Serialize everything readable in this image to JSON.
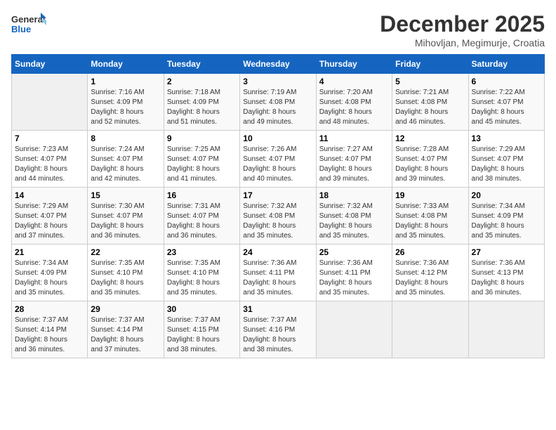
{
  "logo": {
    "line1": "General",
    "line2": "Blue"
  },
  "title": "December 2025",
  "subtitle": "Mihovljan, Megimurje, Croatia",
  "days_of_week": [
    "Sunday",
    "Monday",
    "Tuesday",
    "Wednesday",
    "Thursday",
    "Friday",
    "Saturday"
  ],
  "weeks": [
    [
      {
        "day": "",
        "info": ""
      },
      {
        "day": "1",
        "info": "Sunrise: 7:16 AM\nSunset: 4:09 PM\nDaylight: 8 hours\nand 52 minutes."
      },
      {
        "day": "2",
        "info": "Sunrise: 7:18 AM\nSunset: 4:09 PM\nDaylight: 8 hours\nand 51 minutes."
      },
      {
        "day": "3",
        "info": "Sunrise: 7:19 AM\nSunset: 4:08 PM\nDaylight: 8 hours\nand 49 minutes."
      },
      {
        "day": "4",
        "info": "Sunrise: 7:20 AM\nSunset: 4:08 PM\nDaylight: 8 hours\nand 48 minutes."
      },
      {
        "day": "5",
        "info": "Sunrise: 7:21 AM\nSunset: 4:08 PM\nDaylight: 8 hours\nand 46 minutes."
      },
      {
        "day": "6",
        "info": "Sunrise: 7:22 AM\nSunset: 4:07 PM\nDaylight: 8 hours\nand 45 minutes."
      }
    ],
    [
      {
        "day": "7",
        "info": "Sunrise: 7:23 AM\nSunset: 4:07 PM\nDaylight: 8 hours\nand 44 minutes."
      },
      {
        "day": "8",
        "info": "Sunrise: 7:24 AM\nSunset: 4:07 PM\nDaylight: 8 hours\nand 42 minutes."
      },
      {
        "day": "9",
        "info": "Sunrise: 7:25 AM\nSunset: 4:07 PM\nDaylight: 8 hours\nand 41 minutes."
      },
      {
        "day": "10",
        "info": "Sunrise: 7:26 AM\nSunset: 4:07 PM\nDaylight: 8 hours\nand 40 minutes."
      },
      {
        "day": "11",
        "info": "Sunrise: 7:27 AM\nSunset: 4:07 PM\nDaylight: 8 hours\nand 39 minutes."
      },
      {
        "day": "12",
        "info": "Sunrise: 7:28 AM\nSunset: 4:07 PM\nDaylight: 8 hours\nand 39 minutes."
      },
      {
        "day": "13",
        "info": "Sunrise: 7:29 AM\nSunset: 4:07 PM\nDaylight: 8 hours\nand 38 minutes."
      }
    ],
    [
      {
        "day": "14",
        "info": "Sunrise: 7:29 AM\nSunset: 4:07 PM\nDaylight: 8 hours\nand 37 minutes."
      },
      {
        "day": "15",
        "info": "Sunrise: 7:30 AM\nSunset: 4:07 PM\nDaylight: 8 hours\nand 36 minutes."
      },
      {
        "day": "16",
        "info": "Sunrise: 7:31 AM\nSunset: 4:07 PM\nDaylight: 8 hours\nand 36 minutes."
      },
      {
        "day": "17",
        "info": "Sunrise: 7:32 AM\nSunset: 4:08 PM\nDaylight: 8 hours\nand 35 minutes."
      },
      {
        "day": "18",
        "info": "Sunrise: 7:32 AM\nSunset: 4:08 PM\nDaylight: 8 hours\nand 35 minutes."
      },
      {
        "day": "19",
        "info": "Sunrise: 7:33 AM\nSunset: 4:08 PM\nDaylight: 8 hours\nand 35 minutes."
      },
      {
        "day": "20",
        "info": "Sunrise: 7:34 AM\nSunset: 4:09 PM\nDaylight: 8 hours\nand 35 minutes."
      }
    ],
    [
      {
        "day": "21",
        "info": "Sunrise: 7:34 AM\nSunset: 4:09 PM\nDaylight: 8 hours\nand 35 minutes."
      },
      {
        "day": "22",
        "info": "Sunrise: 7:35 AM\nSunset: 4:10 PM\nDaylight: 8 hours\nand 35 minutes."
      },
      {
        "day": "23",
        "info": "Sunrise: 7:35 AM\nSunset: 4:10 PM\nDaylight: 8 hours\nand 35 minutes."
      },
      {
        "day": "24",
        "info": "Sunrise: 7:36 AM\nSunset: 4:11 PM\nDaylight: 8 hours\nand 35 minutes."
      },
      {
        "day": "25",
        "info": "Sunrise: 7:36 AM\nSunset: 4:11 PM\nDaylight: 8 hours\nand 35 minutes."
      },
      {
        "day": "26",
        "info": "Sunrise: 7:36 AM\nSunset: 4:12 PM\nDaylight: 8 hours\nand 35 minutes."
      },
      {
        "day": "27",
        "info": "Sunrise: 7:36 AM\nSunset: 4:13 PM\nDaylight: 8 hours\nand 36 minutes."
      }
    ],
    [
      {
        "day": "28",
        "info": "Sunrise: 7:37 AM\nSunset: 4:14 PM\nDaylight: 8 hours\nand 36 minutes."
      },
      {
        "day": "29",
        "info": "Sunrise: 7:37 AM\nSunset: 4:14 PM\nDaylight: 8 hours\nand 37 minutes."
      },
      {
        "day": "30",
        "info": "Sunrise: 7:37 AM\nSunset: 4:15 PM\nDaylight: 8 hours\nand 38 minutes."
      },
      {
        "day": "31",
        "info": "Sunrise: 7:37 AM\nSunset: 4:16 PM\nDaylight: 8 hours\nand 38 minutes."
      },
      {
        "day": "",
        "info": ""
      },
      {
        "day": "",
        "info": ""
      },
      {
        "day": "",
        "info": ""
      }
    ]
  ]
}
